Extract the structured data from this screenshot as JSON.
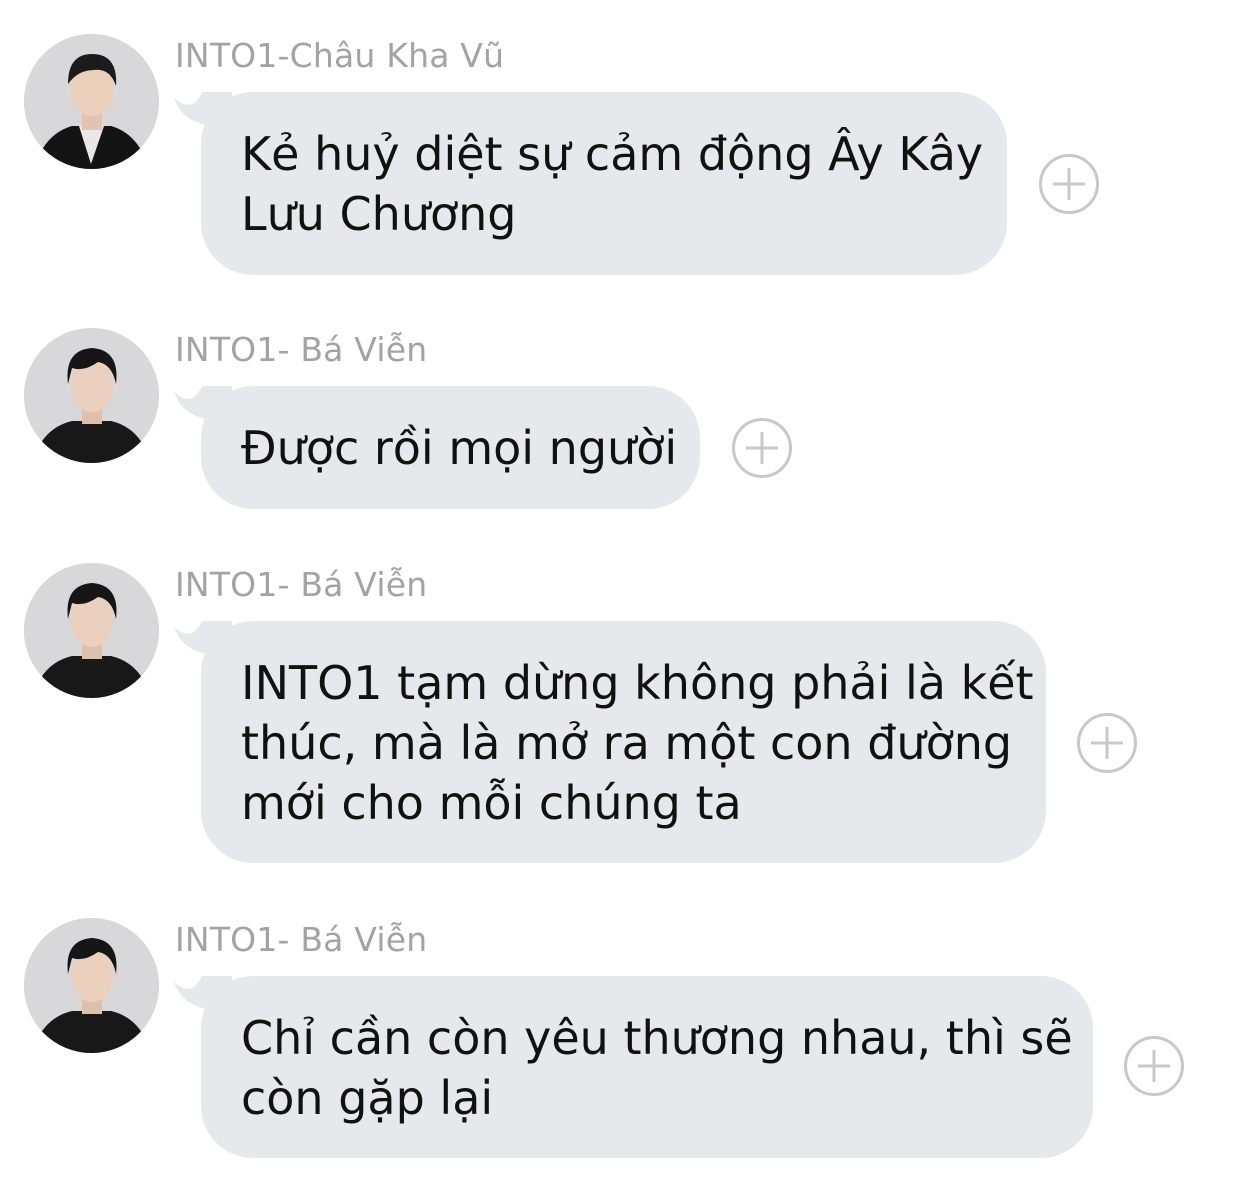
{
  "messages": [
    {
      "sender": "INTO1-Châu Kha Vũ",
      "lines": [
        "Kẻ huỷ diệt sự cảm động Ây Kây",
        "Lưu Chương"
      ],
      "avatar": "avatar-chau-kha-vu"
    },
    {
      "sender": "INTO1- Bá Viễn",
      "lines": [
        "Được rồi mọi người"
      ],
      "avatar": "avatar-ba-vien"
    },
    {
      "sender": "INTO1- Bá Viễn",
      "lines": [
        "INTO1 tạm dừng không phải là kết",
        "thúc, mà là mở ra một con đường",
        "mới cho mỗi chúng ta"
      ],
      "avatar": "avatar-ba-vien"
    },
    {
      "sender": "INTO1- Bá Viễn",
      "lines": [
        "Chỉ cần còn yêu thương nhau, thì sẽ",
        "còn gặp lại"
      ],
      "avatar": "avatar-ba-vien"
    }
  ],
  "icons": {
    "react": "plus-circle-icon"
  },
  "colors": {
    "bubble": "#e6e8ec",
    "sender": "#a3a3a6",
    "text": "#111111",
    "icon": "#c8c8cc"
  }
}
